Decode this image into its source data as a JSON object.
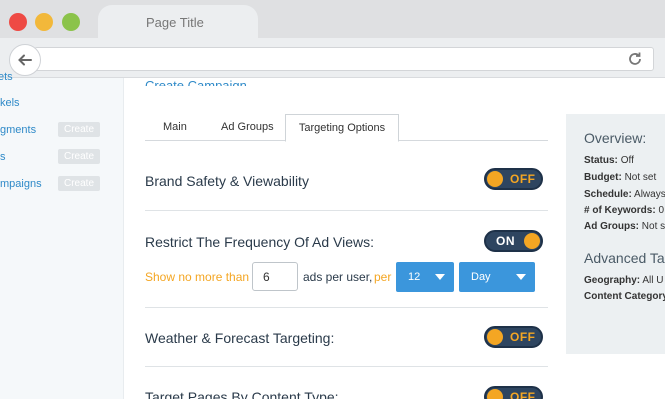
{
  "browser": {
    "tab_title": "Page Title"
  },
  "sidebar": {
    "items": [
      {
        "label": "ets",
        "has_create": false
      },
      {
        "label": "kels",
        "has_create": false
      },
      {
        "label": "gments",
        "has_create": true
      },
      {
        "label": "s",
        "has_create": true
      },
      {
        "label": "mpaigns",
        "has_create": true
      }
    ],
    "create_label": "Create"
  },
  "main": {
    "title": "Create Campaign",
    "tabs": [
      "Main",
      "Ad Groups",
      "Targeting Options"
    ],
    "active_tab": "Targeting Options",
    "options": [
      {
        "label": "Brand Safety & Viewability",
        "state": "OFF"
      },
      {
        "label": "Restrict The Frequency Of Ad Views:",
        "state": "ON"
      },
      {
        "label": "Weather & Forecast Targeting:",
        "state": "OFF"
      },
      {
        "label": "Target Pages By Content Type:",
        "state": "OFF"
      }
    ],
    "frequency": {
      "prefix": "Show no more than",
      "count": "6",
      "middle": "ads per user,",
      "per": "per",
      "period_value": "12",
      "period_unit": "Day"
    }
  },
  "overview": {
    "title": "Overview:",
    "rows": [
      {
        "key": "Status:",
        "value": "Off"
      },
      {
        "key": "Budget:",
        "value": "Not set"
      },
      {
        "key": "Schedule:",
        "value": "Always"
      },
      {
        "key": "# of Keywords:",
        "value": "0"
      },
      {
        "key": "Ad Groups:",
        "value": "Not se"
      }
    ],
    "advanced_title": "Advanced Tar",
    "advanced_rows": [
      {
        "key": "Geography:",
        "value": "All U"
      },
      {
        "key": "Content Category",
        "value": ""
      }
    ]
  },
  "colors": {
    "accent_blue": "#2f8ac8",
    "toggle_dark": "#2e4560",
    "toggle_orange": "#f4a623",
    "select_blue": "#3b96dc"
  }
}
